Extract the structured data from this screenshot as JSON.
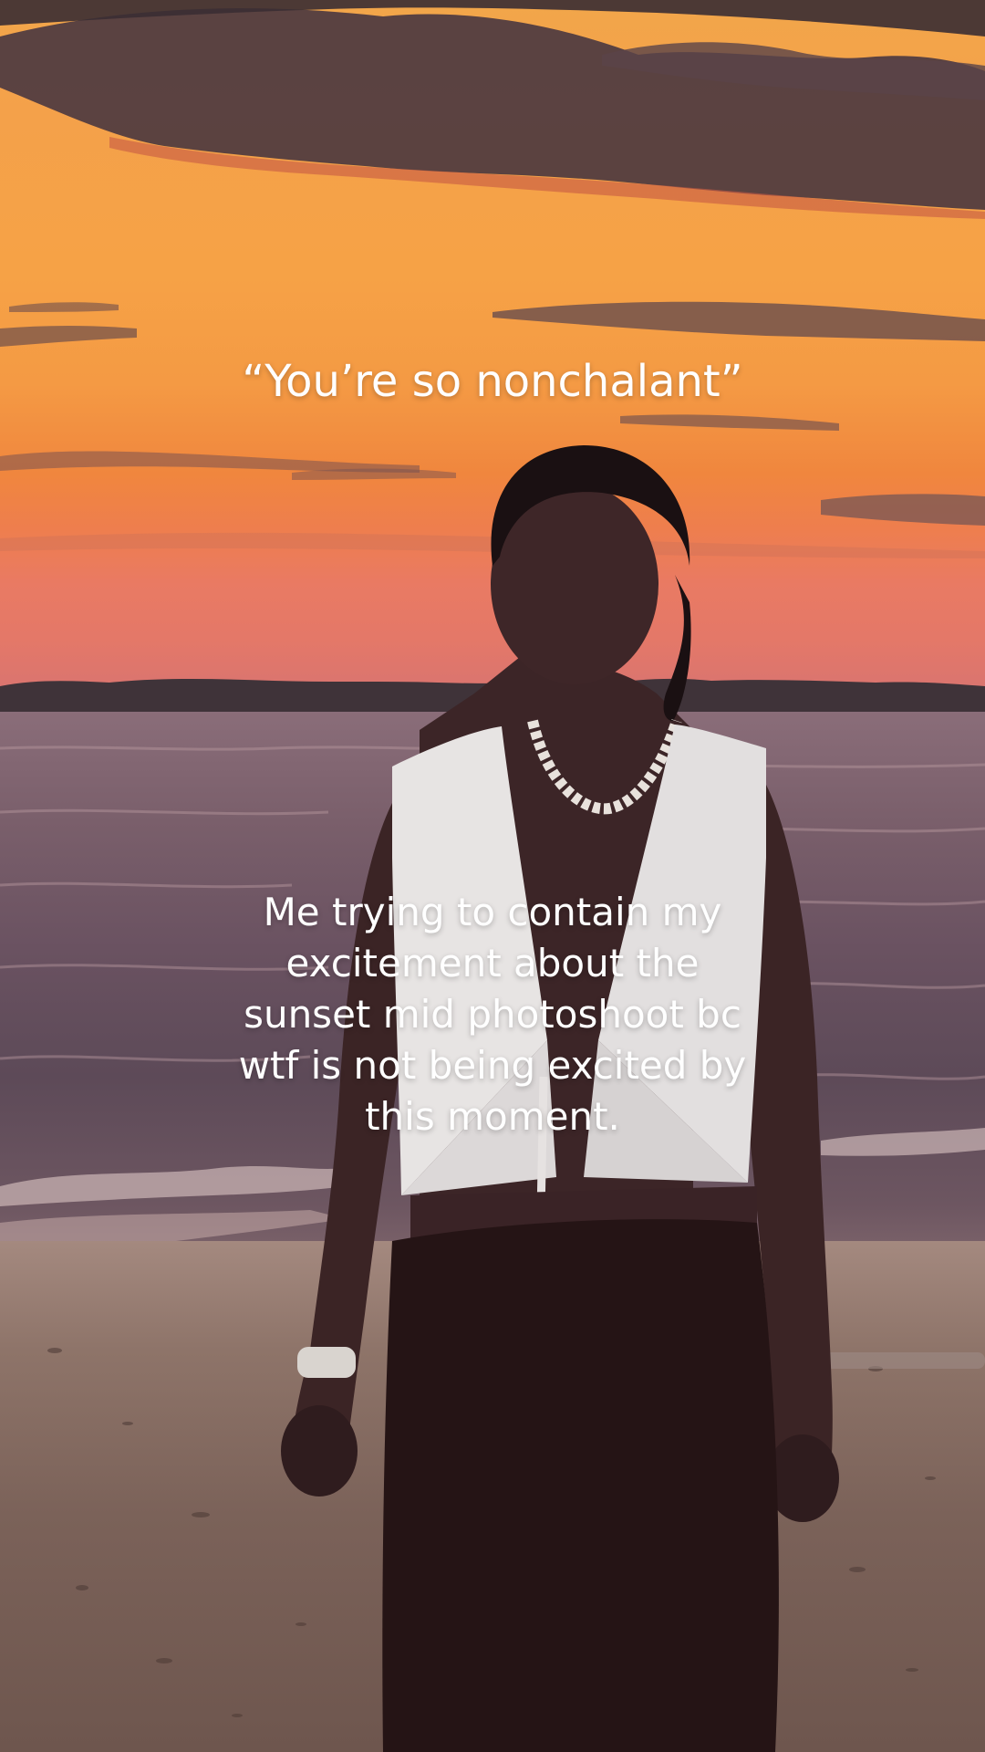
{
  "overlay": {
    "top_text": "“You’re so nonchalant”",
    "main_text": "Me trying to contain my\nexcitement about the\nsunset mid photoshoot bc\nwtf is not being excited by\nthis moment."
  },
  "colors": {
    "sky_top": "#f2a64a",
    "sky_horizon": "#e47868",
    "water": "#6a5261",
    "sand": "#7b6259",
    "caption_text": "#ffffff"
  }
}
